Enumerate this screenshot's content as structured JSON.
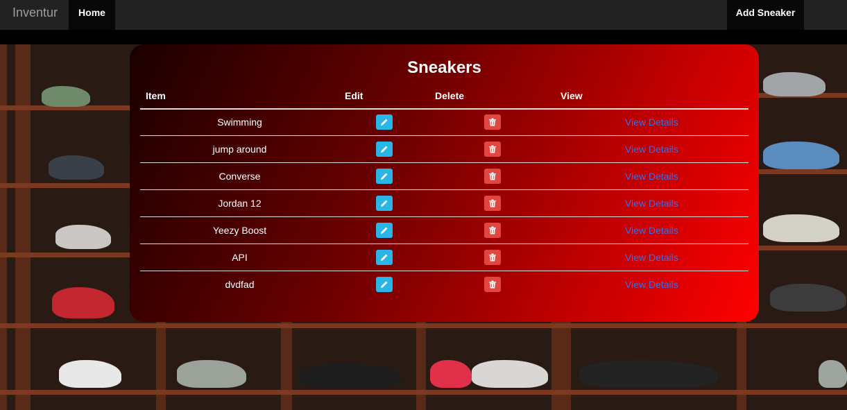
{
  "navbar": {
    "brand": "Inventur",
    "home_label": "Home",
    "add_label": "Add Sneaker"
  },
  "card": {
    "title": "Sneakers",
    "columns": [
      "Item",
      "Edit",
      "Delete",
      "View"
    ],
    "rows": [
      {
        "item": "Swimming",
        "view_label": "View Details"
      },
      {
        "item": "jump around",
        "view_label": "View Details"
      },
      {
        "item": "Converse",
        "view_label": "View Details"
      },
      {
        "item": "Jordan 12",
        "view_label": "View Details"
      },
      {
        "item": "Yeezy Boost",
        "view_label": "View Details"
      },
      {
        "item": "API",
        "view_label": "View Details"
      },
      {
        "item": "dvdfad",
        "view_label": "View Details"
      }
    ]
  },
  "icons": {
    "edit": "pencil-icon",
    "delete": "trash-icon"
  },
  "colors": {
    "navbar": "#222222",
    "edit_button": "#29b6e6",
    "delete_button": "#e2473f",
    "link": "#3a6fe8",
    "card_gradient_start": "#1a0000",
    "card_gradient_end": "#ff0000"
  }
}
